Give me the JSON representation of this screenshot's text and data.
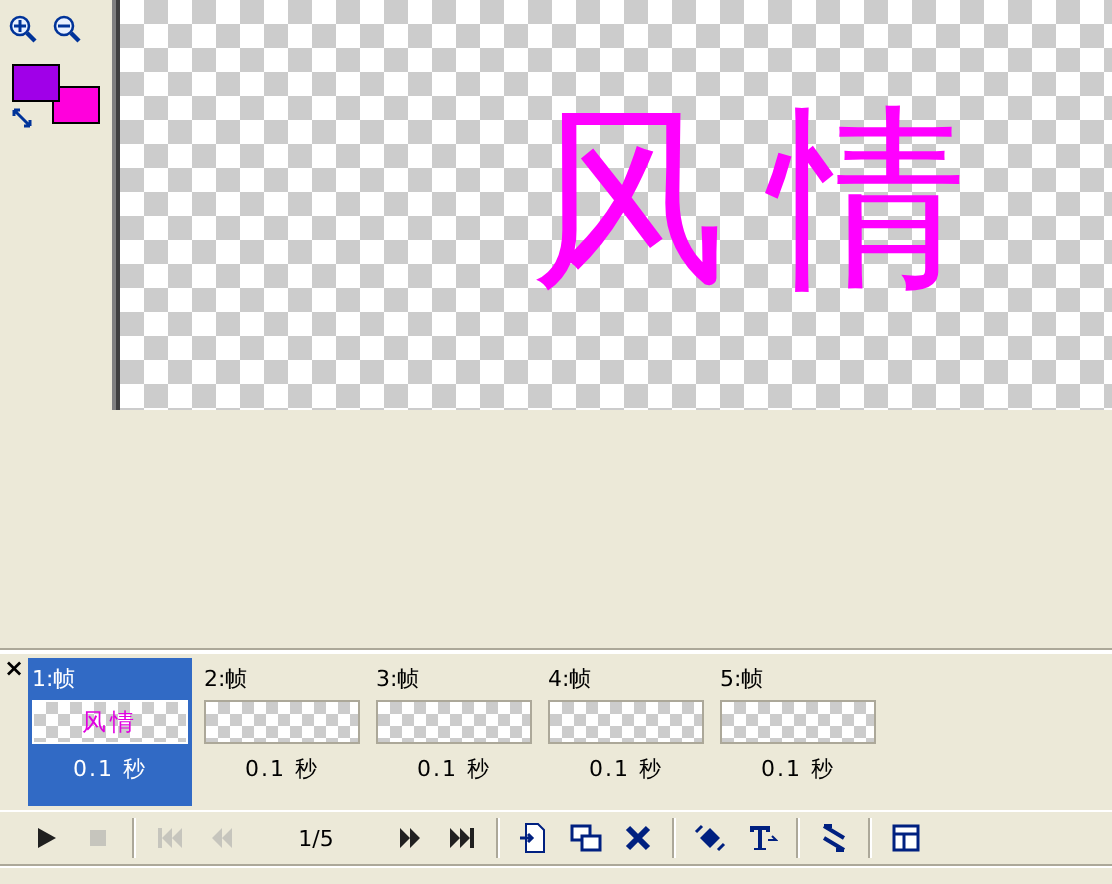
{
  "tools": [
    {
      "kind": "zoom-in"
    },
    {
      "kind": "zoom-out"
    }
  ],
  "colors": [
    {
      "kind": "foreground",
      "color": "#a000e8"
    },
    {
      "kind": "background",
      "color": "#ff00dc"
    }
  ],
  "canvas": {
    "text": "风情"
  },
  "frames": [
    {
      "label": "1:帧",
      "thumbnail": "风情",
      "duration": "0.1 秒",
      "selected": true
    },
    {
      "label": "2:帧",
      "duration": "0.1 秒",
      "selected": false
    },
    {
      "label": "3:帧",
      "duration": "0.1 秒",
      "selected": false
    },
    {
      "label": "4:帧",
      "duration": "0.1 秒",
      "selected": false
    },
    {
      "label": "5:帧",
      "duration": "0.1 秒",
      "selected": false
    }
  ],
  "close_glyph": "×",
  "playback": [
    {
      "kind": "play",
      "disabled": false
    },
    {
      "kind": "stop",
      "disabled": true
    },
    {
      "kind": "sep"
    },
    {
      "kind": "first",
      "disabled": true
    },
    {
      "kind": "prev",
      "disabled": true
    },
    {
      "kind": "counter",
      "text": "1/5"
    },
    {
      "kind": "next",
      "disabled": false
    },
    {
      "kind": "last",
      "disabled": false
    },
    {
      "kind": "sep"
    },
    {
      "kind": "add-frame",
      "disabled": false
    },
    {
      "kind": "duplicate",
      "disabled": false
    },
    {
      "kind": "delete",
      "disabled": false
    },
    {
      "kind": "sep"
    },
    {
      "kind": "tween",
      "disabled": false
    },
    {
      "kind": "text-effect",
      "disabled": false
    },
    {
      "kind": "sep"
    },
    {
      "kind": "reverse",
      "disabled": false
    },
    {
      "kind": "sep"
    },
    {
      "kind": "properties",
      "disabled": false
    }
  ]
}
